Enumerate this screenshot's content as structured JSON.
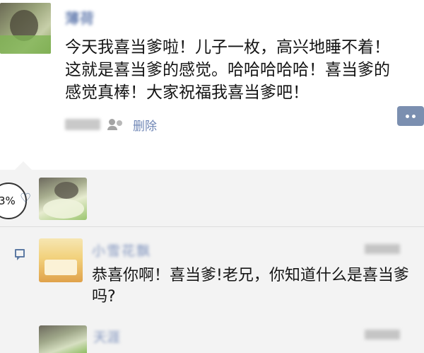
{
  "post": {
    "author": "薄荷",
    "text": "今天我喜当爹啦！儿子一枚，高兴地睡不着！这就是喜当爹的感觉。哈哈哈哈哈！喜当爹的感觉真棒！大家祝福我喜当爹吧！",
    "delete_label": "删除",
    "more_icon": "more-dots-icon"
  },
  "likes": {
    "badge": "3%",
    "icon": "heart-icon"
  },
  "comments": [
    {
      "name": "小雪花飘",
      "text": "恭喜你啊！喜当爹!老兄，你知道什么是喜当爹吗?"
    },
    {
      "name": "天涯"
    }
  ]
}
